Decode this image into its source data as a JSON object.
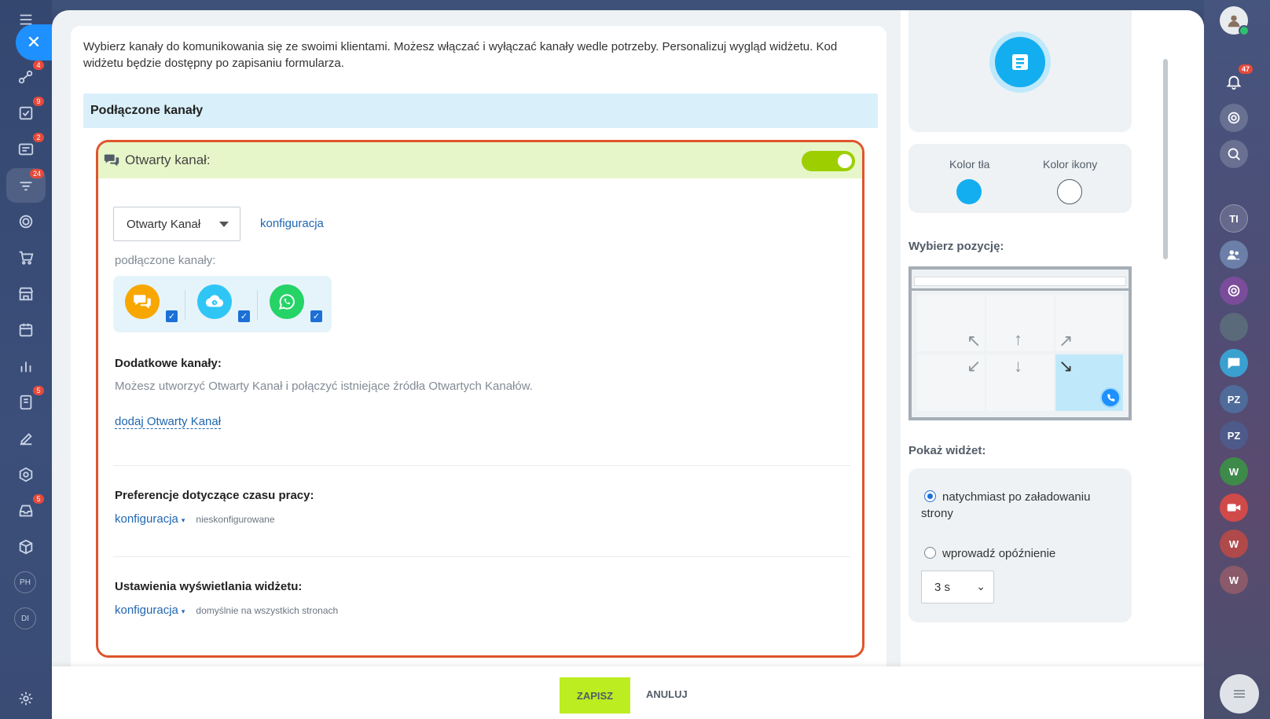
{
  "intro_text": "Wybierz kanały do komunikowania się ze swoimi klientami. Możesz włączać i wyłączać kanały wedle potrzeby. Personalizuj wygląd widżetu. Kod widżetu będzie dostępny po zapisaniu formularza.",
  "connected_section_title": "Podłączone kanały",
  "open_channel": {
    "title": "Otwarty kanał:",
    "enabled": true,
    "select_value": "Otwarty Kanał",
    "config_link": "konfiguracja",
    "connected_label": "podłączone kanały:",
    "connected_channels": [
      {
        "icon": "chat-icon",
        "color": "#f7a700",
        "checked": true
      },
      {
        "icon": "cloud-icon",
        "color": "#2fc6f6",
        "checked": true
      },
      {
        "icon": "whatsapp-icon",
        "color": "#25d366",
        "checked": true
      }
    ],
    "additional_title": "Dodatkowe kanały:",
    "additional_desc": "Możesz utworzyć Otwarty Kanał i połączyć istniejące źródła Otwartych Kanałów.",
    "add_link": "dodaj Otwarty Kanał",
    "work_time_title": "Preferencje dotyczące czasu pracy:",
    "work_time_link": "konfiguracja",
    "work_time_status": "nieskonfigurowane",
    "display_title": "Ustawienia wyświetlania widżetu:",
    "display_link": "konfiguracja",
    "display_status": "domyślnie na wszystkich stronach"
  },
  "preview": {
    "bg_color_label": "Kolor tła",
    "icon_color_label": "Kolor ikony",
    "bg_color": "#12aef0",
    "icon_color": "#ffffff",
    "position_title": "Wybierz pozycję:",
    "selected_position": "bottom-right",
    "show_title": "Pokaż widżet:",
    "option_immediate": "natychmiast po załadowaniu strony",
    "option_delay": "wprowadź opóźnienie",
    "delay_value": "3 s",
    "selected_option": "immediate"
  },
  "footer": {
    "save_label": "ZAPISZ",
    "cancel_label": "ANULUJ"
  },
  "left_sidebar": {
    "badges": [
      "4",
      "9",
      "2",
      "24",
      "5",
      "5"
    ],
    "avatars": [
      "PH",
      "DI"
    ]
  },
  "right_sidebar": {
    "notification_count": "47",
    "avatars": [
      "TI",
      "PZ",
      "PZ",
      "W",
      "W",
      "W"
    ]
  },
  "colors": {
    "accent": "#1e90ff",
    "highlight_border": "#e0542c",
    "save_button": "#bbed21",
    "toggle_on": "#9dcf00"
  }
}
